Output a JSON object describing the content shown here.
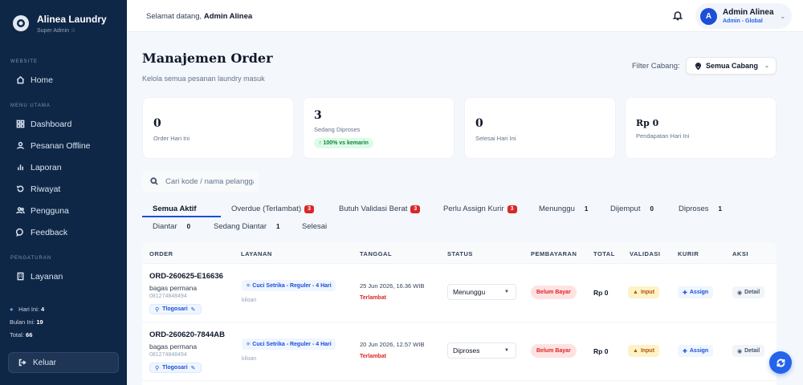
{
  "sidebar": {
    "brand_title": "Alinea Laundry",
    "brand_sub": "Super Admin ☆",
    "section_website": "WEBSITE",
    "section_menu": "MENU UTAMA",
    "section_settings": "PENGATURAN",
    "items": [
      {
        "label": "Home",
        "icon": "home-icon"
      },
      {
        "label": "Dashboard",
        "icon": "grid-icon"
      },
      {
        "label": "Pesanan Offline",
        "icon": "user-icon"
      },
      {
        "label": "Laporan",
        "icon": "bar-chart-icon"
      },
      {
        "label": "Riwayat",
        "icon": "history-icon"
      },
      {
        "label": "Pengguna",
        "icon": "users-icon"
      },
      {
        "label": "Feedback",
        "icon": "chat-icon"
      },
      {
        "label": "Layanan",
        "icon": "building-icon"
      }
    ],
    "stats": {
      "today_label": "Hari Ini:",
      "today_value": "4",
      "month_label": "Bulan Ini:",
      "month_value": "19",
      "total_label": "Total:",
      "total_value": "66"
    },
    "logout": "Keluar"
  },
  "topbar": {
    "welcome_prefix": "Selamat datang,",
    "welcome_name": "Admin Alinea",
    "user_initial": "A",
    "user_name": "Admin Alinea",
    "user_role": "Admin - Global"
  },
  "page": {
    "title": "Manajemen Order",
    "subtitle": "Kelola semua pesanan laundry masuk",
    "filter_label": "Filter Cabang:",
    "filter_value": "Semua Cabang"
  },
  "cards": [
    {
      "value": "0",
      "label": "Order Hari Ini"
    },
    {
      "value": "3",
      "label": "Sedang Diproses",
      "trend": "↑ 100% vs kemarin"
    },
    {
      "value": "0",
      "label": "Selesai Hari Ini"
    },
    {
      "value": "Rp 0",
      "label": "Pendapatan Hari Ini"
    }
  ],
  "search": {
    "placeholder": "Cari kode / nama pelanggan"
  },
  "tabs": [
    {
      "label": "Semua Aktif"
    },
    {
      "label": "Overdue (Terlambat)",
      "badge": "3"
    },
    {
      "label": "Butuh Validasi Berat",
      "badge": "3"
    },
    {
      "label": "Perlu Assign Kurir",
      "badge": "3"
    },
    {
      "label": "Menunggu",
      "count": "1"
    },
    {
      "label": "Dijemput",
      "count": "0"
    },
    {
      "label": "Diproses",
      "count": "1"
    },
    {
      "label": "Diantar",
      "count": "0"
    },
    {
      "label": "Sedang Diantar",
      "count": "1"
    },
    {
      "label": "Selesai"
    }
  ],
  "table": {
    "headers": [
      "ORDER",
      "LAYANAN",
      "TANGGAL",
      "STATUS",
      "PEMBAYARAN",
      "TOTAL",
      "VALIDASI",
      "KURIR",
      "AKSI"
    ],
    "rows": [
      {
        "code": "ORD-260625-E16636",
        "customer": "bagas permana",
        "phone": "081274848494",
        "branch": "Tlogosari",
        "service": "Cuci Setrika - Reguler - 4 Hari",
        "service_sub": "kiloan",
        "date": "25 Jun 2026, 16.36 WIB",
        "late": "Terlambat",
        "status": "Menunggu",
        "payment": "Belum Bayar",
        "total": "Rp 0",
        "validation": "Input",
        "courier": "Assign",
        "action": "Detail"
      },
      {
        "code": "ORD-260620-7844AB",
        "customer": "bagas permana",
        "phone": "081274848494",
        "branch": "Tlogosari",
        "service": "Cuci Setrika - Reguler - 4 Hari",
        "service_sub": "kiloan",
        "date": "20 Jun 2026, 12.57 WIB",
        "late": "Terlambat",
        "status": "Diproses",
        "payment": "Belum Bayar",
        "total": "Rp 0",
        "validation": "Input",
        "courier": "Assign",
        "action": "Detail"
      }
    ]
  },
  "colors": {
    "sidebar_bg": "#0f2747",
    "accent": "#1d4ed8",
    "danger": "#dc2626"
  }
}
